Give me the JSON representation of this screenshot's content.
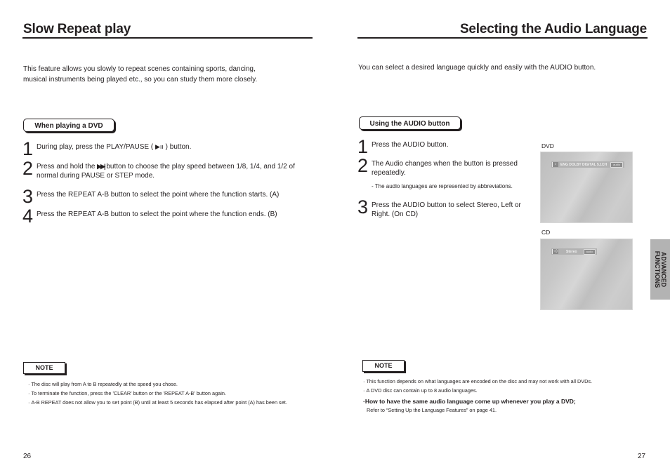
{
  "left_page": {
    "title": "Slow Repeat play",
    "intro": [
      "This feature allows you slowly to repeat scenes containing sports, dancing,",
      "musical instruments being played etc., so you can study them more closely."
    ],
    "section_tab": "When playing a DVD",
    "steps": [
      {
        "num": "1",
        "text_before": "During play, press the PLAY/PAUSE ( ",
        "icon": "▶ıı",
        "text_after": " ) button."
      },
      {
        "num": "2",
        "text_before": "Press and hold the ",
        "icon": "▶▶|",
        "text_after": " button to choose the play speed between 1/8, 1/4, and 1/2 of normal during PAUSE or STEP mode."
      },
      {
        "num": "3",
        "text": "Press the REPEAT A-B button to select the point where the function starts. (A)"
      },
      {
        "num": "4",
        "text": "Press the REPEAT A-B button to select the point where the function ends. (B)"
      }
    ],
    "note": {
      "label": "NOTE",
      "items": [
        "The disc will play from A to B repeatedly at the speed you chose.",
        "To terminate the function, press the 'CLEAR' button or the 'REPEAT A-B' button again.",
        "A-B REPEAT does not allow you to set point (B) until at least 5 seconds has elapsed after point (A) has been set."
      ]
    },
    "page_number": "26"
  },
  "right_page": {
    "title": "Selecting the Audio Language",
    "intro": "You can select a desired language quickly and easily with the AUDIO button.",
    "section_tab": "Using the AUDIO button",
    "steps": [
      {
        "num": "1",
        "text": "Press the AUDIO button."
      },
      {
        "num": "2",
        "text": "The Audio changes when the button is pressed repeatedly.",
        "sub": "- The audio languages are represented by abbreviations."
      },
      {
        "num": "3",
        "text": "Press the AUDIO button to select Stereo, Left or Right. (On CD)"
      }
    ],
    "screens": [
      {
        "label": "DVD",
        "osd_icon": "♪",
        "osd_text": "ENG  DOLBY DIGITAL  5.1CH",
        "osd_badge": "audio"
      },
      {
        "label": "CD",
        "osd_icon": "◁)",
        "osd_text": "Stereo",
        "osd_badge": "audio"
      }
    ],
    "side_tab": [
      "ADVANCED",
      "FUNCTIONS"
    ],
    "note": {
      "label": "NOTE",
      "items": [
        "This function depends on what languages are encoded on the disc and may not work with all DVDs.",
        "A DVD disc can contain up to 8 audio languages."
      ],
      "bold_item": "How to have the same audio language come up whenever you play a DVD;",
      "reference": "Refer to “Setting Up the Language Features” on page 41."
    },
    "page_number": "27"
  }
}
